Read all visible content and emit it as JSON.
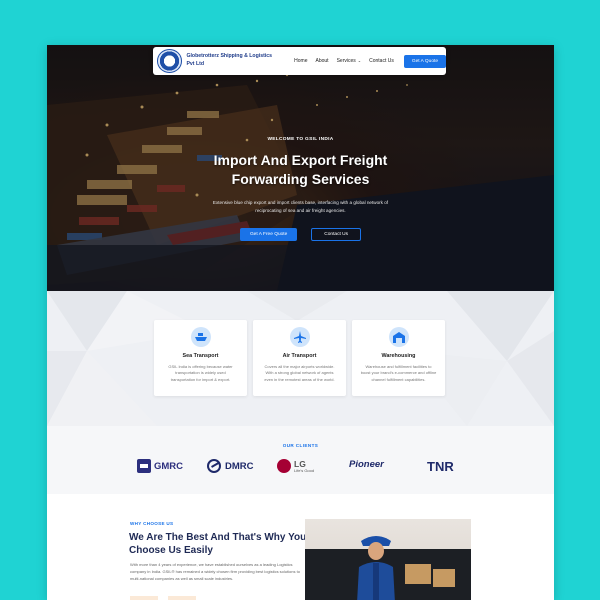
{
  "nav": {
    "brand": "Globetrotterz Shipping & Logistics Pvt Ltd",
    "links": [
      "Home",
      "About",
      "Services",
      "Contact Us"
    ],
    "cta": "Get A Quote"
  },
  "hero": {
    "eyebrow": "WELCOME TO GSIL INDIA",
    "title_line1": "Import And Export Freight",
    "title_line2": "Forwarding Services",
    "description": "Extensive blue chip export and import clients base, interfacing with a global network of reciprocating of sea and air freight agencies.",
    "primary_button": "Get A Free Quote",
    "secondary_button": "Contact Us"
  },
  "services": [
    {
      "title": "Sea Transport",
      "text": "GSIL India is offering because water transportation is widely used transportation for import & export.",
      "icon": "ship-icon"
    },
    {
      "title": "Air Transport",
      "text": "Covers all the major airports worldwide. With a strong global network of agents even in the remotest areas of the world.",
      "icon": "airplane-icon"
    },
    {
      "title": "Warehousing",
      "text": "Warehouse and fulfillment facilities to boost your brand's e-commerce and offline channel fulfillment capabilities.",
      "icon": "warehouse-icon"
    }
  ],
  "clients": {
    "title": "OUR CLIENTS",
    "logos": [
      "GMRC",
      "DMRC",
      "LG",
      "Life's Good",
      "Pioneer",
      "TNR"
    ]
  },
  "why": {
    "eyebrow": "WHY CHOOSE US",
    "title": "We Are The Best And That's Why You Can Choose Us Easily",
    "text": "With more than 4 years of experience, we have established ourselves as a leading Logistics company in India. GSIL® has remained a widely chosen firm providing best logistics solutions to multi-national companies as well as small scale industries."
  },
  "colors": {
    "accent": "#1a73e8",
    "background": "#1fd3d3",
    "heading": "#1f2a55"
  }
}
